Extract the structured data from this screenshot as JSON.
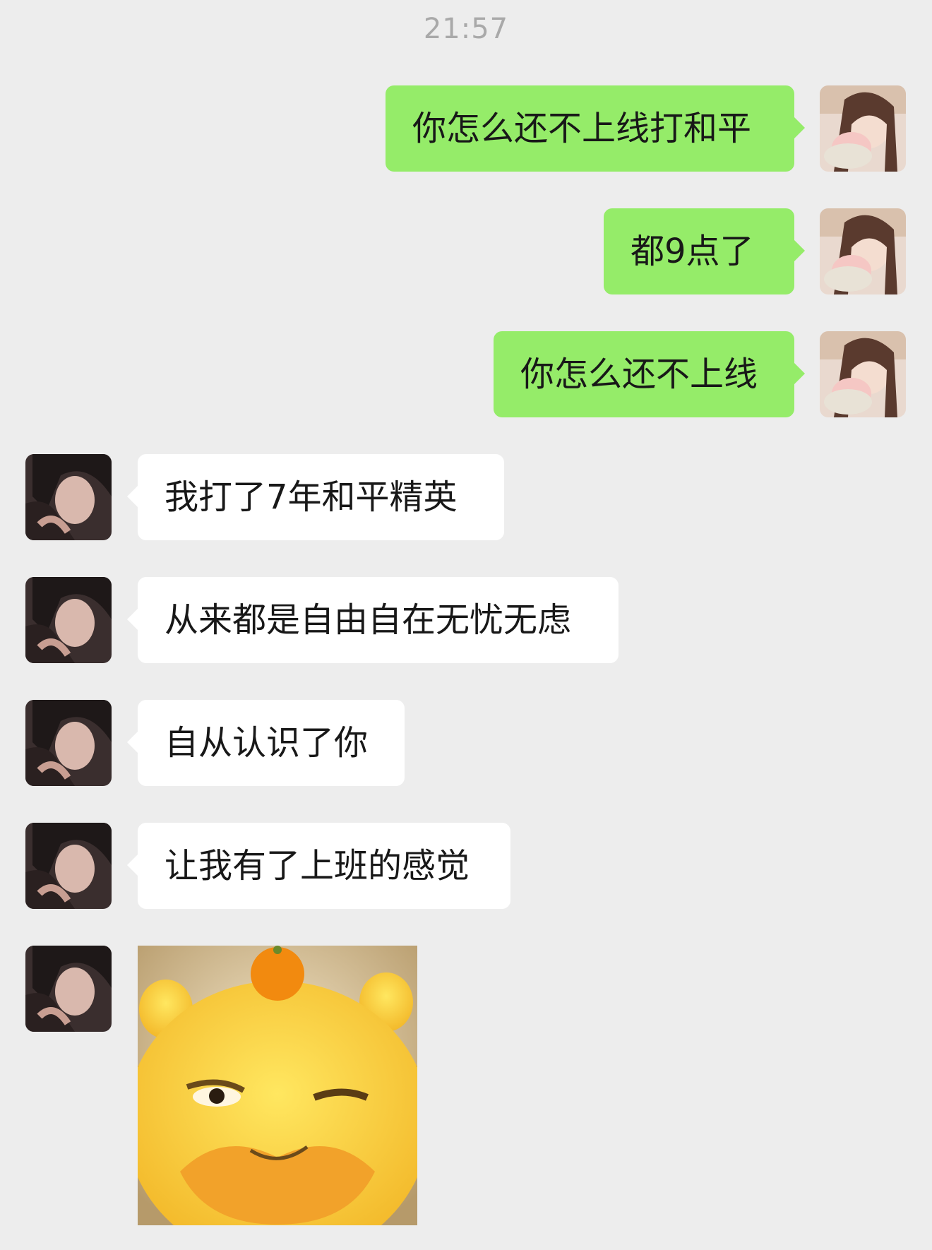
{
  "time": "21:57",
  "messages": [
    {
      "from": "me",
      "text": "你怎么还不上线打和平"
    },
    {
      "from": "me",
      "text": "都9点了"
    },
    {
      "from": "me",
      "text": "你怎么还不上线"
    },
    {
      "from": "other",
      "text": "我打了7年和平精英"
    },
    {
      "from": "other",
      "text": "从来都是自由自在无忧无虑"
    },
    {
      "from": "other",
      "text": "自从认识了你"
    },
    {
      "from": "other",
      "text": "让我有了上班的感觉"
    }
  ],
  "sticker": {
    "icon": "yellow-bear-smirk-sticker"
  },
  "colors": {
    "background": "#ededed",
    "my_bubble": "#95ec69",
    "their_bubble": "#ffffff"
  }
}
